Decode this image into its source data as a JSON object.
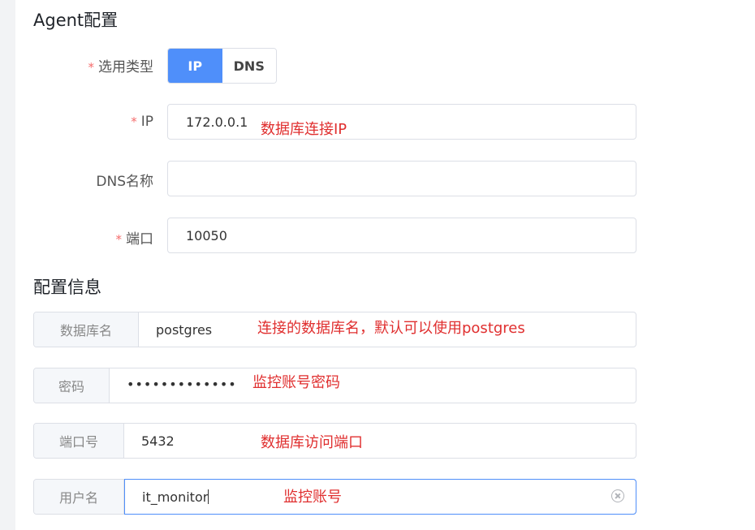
{
  "sections": {
    "agent_title": "Agent配置",
    "config_title": "配置信息"
  },
  "agent": {
    "type_label": "选用类型",
    "type_options": [
      "IP",
      "DNS"
    ],
    "type_selected": "IP",
    "ip_label": "IP",
    "ip_value": "172.0.0.1",
    "ip_note": "数据库连接IP",
    "dns_label": "DNS名称",
    "dns_value": "",
    "port_label": "端口",
    "port_value": "10050",
    "required_mark": "*"
  },
  "config": {
    "db_label": "数据库名",
    "db_value": "postgres",
    "db_note": "连接的数据库名，默认可以使用postgres",
    "password_label": "密码",
    "password_value": "•••••••••••••",
    "password_note": "监控账号密码",
    "port_label": "端口号",
    "port_value": "5432",
    "port_note": "数据库访问端口",
    "user_label": "用户名",
    "user_value": "it_monitor",
    "user_note": "监控账号"
  },
  "colors": {
    "accent": "#4f8ffa",
    "required": "#f56c6c",
    "annotation": "#e02f2f"
  },
  "icons": {
    "clear": "circle-x-icon"
  }
}
